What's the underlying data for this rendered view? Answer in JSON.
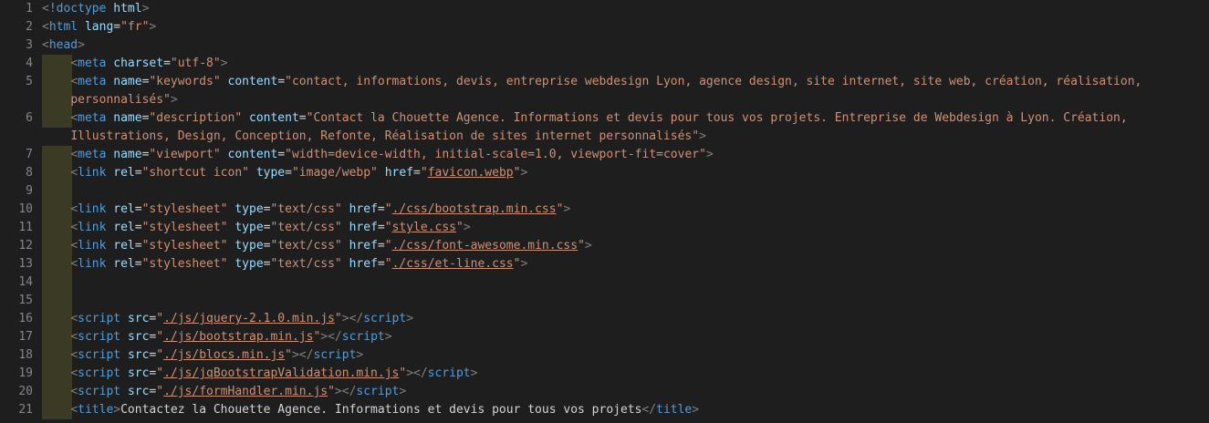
{
  "colors": {
    "background": "#1e1e1e",
    "line_number": "#858585",
    "tag": "#569cd6",
    "punctuation": "#808080",
    "attribute": "#9cdcfe",
    "string": "#ce9178",
    "text": "#d4d4d4",
    "indent_guide": "#3b3a24"
  },
  "lines": [
    {
      "n": "1",
      "indent": false,
      "tokens": [
        [
          "p",
          "<"
        ],
        [
          "t",
          "!doctype"
        ],
        [
          "x",
          " "
        ],
        [
          "a",
          "html"
        ],
        [
          "p",
          ">"
        ]
      ]
    },
    {
      "n": "2",
      "indent": false,
      "tokens": [
        [
          "p",
          "<"
        ],
        [
          "t",
          "html"
        ],
        [
          "x",
          " "
        ],
        [
          "a",
          "lang"
        ],
        [
          "x",
          "="
        ],
        [
          "s",
          "\"fr\""
        ],
        [
          "p",
          ">"
        ]
      ]
    },
    {
      "n": "3",
      "indent": false,
      "tokens": [
        [
          "p",
          "<"
        ],
        [
          "t",
          "head"
        ],
        [
          "p",
          ">"
        ]
      ]
    },
    {
      "n": "4",
      "indent": true,
      "tokens": [
        [
          "x",
          "    "
        ],
        [
          "p",
          "<"
        ],
        [
          "t",
          "meta"
        ],
        [
          "x",
          " "
        ],
        [
          "a",
          "charset"
        ],
        [
          "x",
          "="
        ],
        [
          "s",
          "\"utf-8\""
        ],
        [
          "p",
          ">"
        ]
      ]
    },
    {
      "n": "5",
      "indent": true,
      "tokens": [
        [
          "x",
          "    "
        ],
        [
          "p",
          "<"
        ],
        [
          "t",
          "meta"
        ],
        [
          "x",
          " "
        ],
        [
          "a",
          "name"
        ],
        [
          "x",
          "="
        ],
        [
          "s",
          "\"keywords\""
        ],
        [
          "x",
          " "
        ],
        [
          "a",
          "content"
        ],
        [
          "x",
          "="
        ],
        [
          "s",
          "\"contact, informations, devis, entreprise webdesign Lyon, agence design, site internet, site web, création, réalisation,"
        ]
      ]
    },
    {
      "n": "",
      "indent": true,
      "tokens": [
        [
          "x",
          "    "
        ],
        [
          "s",
          "personnalisés\""
        ],
        [
          "p",
          ">"
        ]
      ]
    },
    {
      "n": "6",
      "indent": true,
      "tokens": [
        [
          "x",
          "    "
        ],
        [
          "p",
          "<"
        ],
        [
          "t",
          "meta"
        ],
        [
          "x",
          " "
        ],
        [
          "a",
          "name"
        ],
        [
          "x",
          "="
        ],
        [
          "s",
          "\"description\""
        ],
        [
          "x",
          " "
        ],
        [
          "a",
          "content"
        ],
        [
          "x",
          "="
        ],
        [
          "s",
          "\"Contact la Chouette Agence. Informations et devis pour tous vos projets. Entreprise de Webdesign à Lyon. Création,"
        ]
      ]
    },
    {
      "n": "",
      "indent": false,
      "tokens": [
        [
          "x",
          "    "
        ],
        [
          "s",
          "Illustrations, Design, Conception, Refonte, Réalisation de sites internet personnalisés\""
        ],
        [
          "p",
          ">"
        ]
      ]
    },
    {
      "n": "7",
      "indent": true,
      "tokens": [
        [
          "x",
          "    "
        ],
        [
          "p",
          "<"
        ],
        [
          "t",
          "meta"
        ],
        [
          "x",
          " "
        ],
        [
          "a",
          "name"
        ],
        [
          "x",
          "="
        ],
        [
          "s",
          "\"viewport\""
        ],
        [
          "x",
          " "
        ],
        [
          "a",
          "content"
        ],
        [
          "x",
          "="
        ],
        [
          "s",
          "\"width=device-width, initial-scale=1.0, viewport-fit=cover\""
        ],
        [
          "p",
          ">"
        ]
      ]
    },
    {
      "n": "8",
      "indent": true,
      "tokens": [
        [
          "x",
          "    "
        ],
        [
          "p",
          "<"
        ],
        [
          "t",
          "link"
        ],
        [
          "x",
          " "
        ],
        [
          "a",
          "rel"
        ],
        [
          "x",
          "="
        ],
        [
          "s",
          "\"shortcut icon\""
        ],
        [
          "x",
          " "
        ],
        [
          "a",
          "type"
        ],
        [
          "x",
          "="
        ],
        [
          "s",
          "\"image/webp\""
        ],
        [
          "x",
          " "
        ],
        [
          "a",
          "href"
        ],
        [
          "x",
          "="
        ],
        [
          "s",
          "\""
        ],
        [
          "u",
          "favicon.webp"
        ],
        [
          "s",
          "\""
        ],
        [
          "p",
          ">"
        ]
      ]
    },
    {
      "n": "9",
      "indent": true,
      "tokens": []
    },
    {
      "n": "10",
      "indent": true,
      "tokens": [
        [
          "x",
          "    "
        ],
        [
          "p",
          "<"
        ],
        [
          "t",
          "link"
        ],
        [
          "x",
          " "
        ],
        [
          "a",
          "rel"
        ],
        [
          "x",
          "="
        ],
        [
          "s",
          "\"stylesheet\""
        ],
        [
          "x",
          " "
        ],
        [
          "a",
          "type"
        ],
        [
          "x",
          "="
        ],
        [
          "s",
          "\"text/css\""
        ],
        [
          "x",
          " "
        ],
        [
          "a",
          "href"
        ],
        [
          "x",
          "="
        ],
        [
          "s",
          "\""
        ],
        [
          "u",
          "./css/bootstrap.min.css"
        ],
        [
          "s",
          "\""
        ],
        [
          "p",
          ">"
        ]
      ]
    },
    {
      "n": "11",
      "indent": true,
      "tokens": [
        [
          "x",
          "    "
        ],
        [
          "p",
          "<"
        ],
        [
          "t",
          "link"
        ],
        [
          "x",
          " "
        ],
        [
          "a",
          "rel"
        ],
        [
          "x",
          "="
        ],
        [
          "s",
          "\"stylesheet\""
        ],
        [
          "x",
          " "
        ],
        [
          "a",
          "type"
        ],
        [
          "x",
          "="
        ],
        [
          "s",
          "\"text/css\""
        ],
        [
          "x",
          " "
        ],
        [
          "a",
          "href"
        ],
        [
          "x",
          "="
        ],
        [
          "s",
          "\""
        ],
        [
          "u",
          "style.css"
        ],
        [
          "s",
          "\""
        ],
        [
          "p",
          ">"
        ]
      ]
    },
    {
      "n": "12",
      "indent": true,
      "tokens": [
        [
          "x",
          "    "
        ],
        [
          "p",
          "<"
        ],
        [
          "t",
          "link"
        ],
        [
          "x",
          " "
        ],
        [
          "a",
          "rel"
        ],
        [
          "x",
          "="
        ],
        [
          "s",
          "\"stylesheet\""
        ],
        [
          "x",
          " "
        ],
        [
          "a",
          "type"
        ],
        [
          "x",
          "="
        ],
        [
          "s",
          "\"text/css\""
        ],
        [
          "x",
          " "
        ],
        [
          "a",
          "href"
        ],
        [
          "x",
          "="
        ],
        [
          "s",
          "\""
        ],
        [
          "u",
          "./css/font-awesome.min.css"
        ],
        [
          "s",
          "\""
        ],
        [
          "p",
          ">"
        ]
      ]
    },
    {
      "n": "13",
      "indent": true,
      "tokens": [
        [
          "x",
          "    "
        ],
        [
          "p",
          "<"
        ],
        [
          "t",
          "link"
        ],
        [
          "x",
          " "
        ],
        [
          "a",
          "rel"
        ],
        [
          "x",
          "="
        ],
        [
          "s",
          "\"stylesheet\""
        ],
        [
          "x",
          " "
        ],
        [
          "a",
          "type"
        ],
        [
          "x",
          "="
        ],
        [
          "s",
          "\"text/css\""
        ],
        [
          "x",
          " "
        ],
        [
          "a",
          "href"
        ],
        [
          "x",
          "="
        ],
        [
          "s",
          "\""
        ],
        [
          "u",
          "./css/et-line.css"
        ],
        [
          "s",
          "\""
        ],
        [
          "p",
          ">"
        ]
      ]
    },
    {
      "n": "14",
      "indent": true,
      "tokens": []
    },
    {
      "n": "15",
      "indent": true,
      "tokens": []
    },
    {
      "n": "16",
      "indent": true,
      "tokens": [
        [
          "x",
          "    "
        ],
        [
          "p",
          "<"
        ],
        [
          "t",
          "script"
        ],
        [
          "x",
          " "
        ],
        [
          "a",
          "src"
        ],
        [
          "x",
          "="
        ],
        [
          "s",
          "\""
        ],
        [
          "u",
          "./js/jquery-2.1.0.min.js"
        ],
        [
          "s",
          "\""
        ],
        [
          "p",
          "></"
        ],
        [
          "t",
          "script"
        ],
        [
          "p",
          ">"
        ]
      ]
    },
    {
      "n": "17",
      "indent": true,
      "tokens": [
        [
          "x",
          "    "
        ],
        [
          "p",
          "<"
        ],
        [
          "t",
          "script"
        ],
        [
          "x",
          " "
        ],
        [
          "a",
          "src"
        ],
        [
          "x",
          "="
        ],
        [
          "s",
          "\""
        ],
        [
          "u",
          "./js/bootstrap.min.js"
        ],
        [
          "s",
          "\""
        ],
        [
          "p",
          "></"
        ],
        [
          "t",
          "script"
        ],
        [
          "p",
          ">"
        ]
      ]
    },
    {
      "n": "18",
      "indent": true,
      "tokens": [
        [
          "x",
          "    "
        ],
        [
          "p",
          "<"
        ],
        [
          "t",
          "script"
        ],
        [
          "x",
          " "
        ],
        [
          "a",
          "src"
        ],
        [
          "x",
          "="
        ],
        [
          "s",
          "\""
        ],
        [
          "u",
          "./js/blocs.min.js"
        ],
        [
          "s",
          "\""
        ],
        [
          "p",
          "></"
        ],
        [
          "t",
          "script"
        ],
        [
          "p",
          ">"
        ]
      ]
    },
    {
      "n": "19",
      "indent": true,
      "tokens": [
        [
          "x",
          "    "
        ],
        [
          "p",
          "<"
        ],
        [
          "t",
          "script"
        ],
        [
          "x",
          " "
        ],
        [
          "a",
          "src"
        ],
        [
          "x",
          "="
        ],
        [
          "s",
          "\""
        ],
        [
          "u",
          "./js/jqBootstrapValidation.min.js"
        ],
        [
          "s",
          "\""
        ],
        [
          "p",
          "></"
        ],
        [
          "t",
          "script"
        ],
        [
          "p",
          ">"
        ]
      ]
    },
    {
      "n": "20",
      "indent": true,
      "tokens": [
        [
          "x",
          "    "
        ],
        [
          "p",
          "<"
        ],
        [
          "t",
          "script"
        ],
        [
          "x",
          " "
        ],
        [
          "a",
          "src"
        ],
        [
          "x",
          "="
        ],
        [
          "s",
          "\""
        ],
        [
          "u",
          "./js/formHandler.min.js"
        ],
        [
          "s",
          "\""
        ],
        [
          "p",
          "></"
        ],
        [
          "t",
          "script"
        ],
        [
          "p",
          ">"
        ]
      ]
    },
    {
      "n": "21",
      "indent": true,
      "tokens": [
        [
          "x",
          "    "
        ],
        [
          "p",
          "<"
        ],
        [
          "t",
          "title"
        ],
        [
          "p",
          ">"
        ],
        [
          "x",
          "Contactez la Chouette Agence. Informations et devis pour tous vos projets"
        ],
        [
          "p",
          "</"
        ],
        [
          "t",
          "title"
        ],
        [
          "p",
          ">"
        ]
      ]
    }
  ]
}
